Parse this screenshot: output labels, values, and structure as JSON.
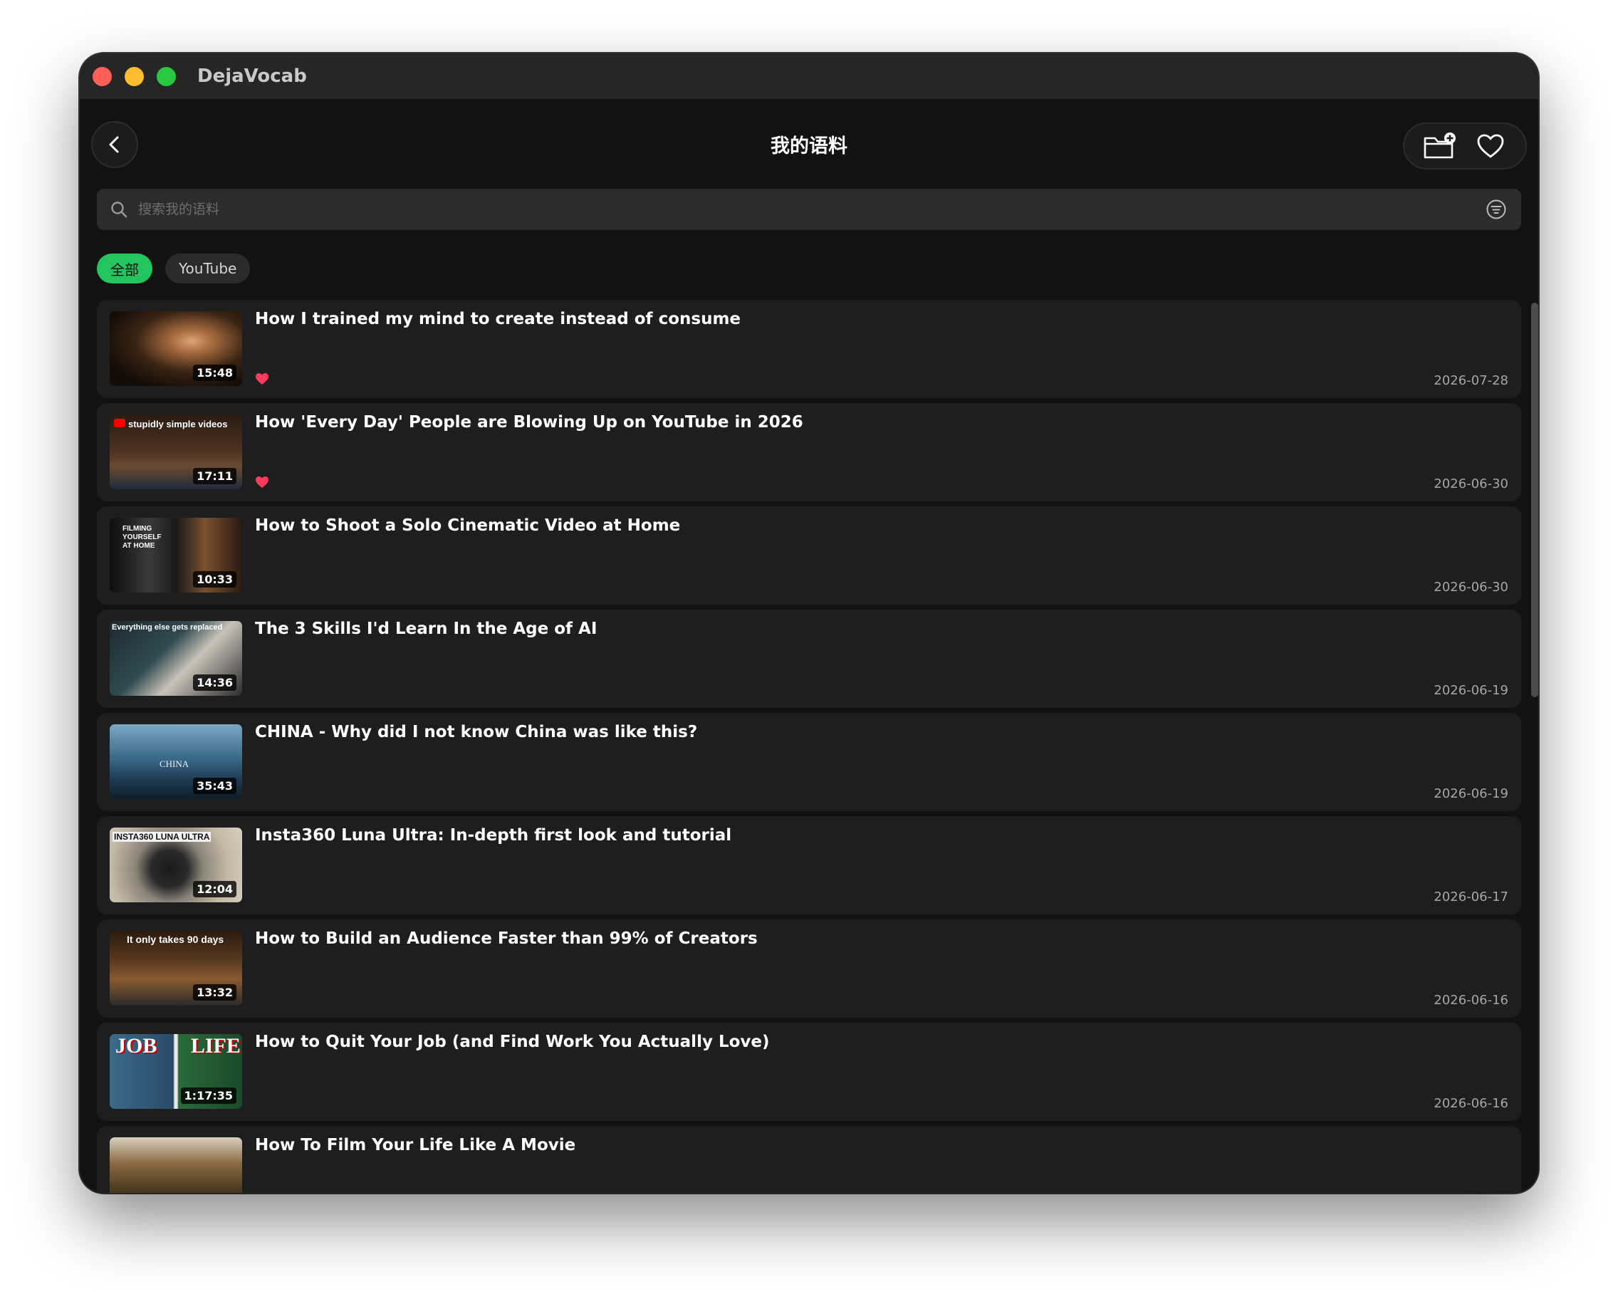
{
  "app": {
    "name": "DejaVocab"
  },
  "header": {
    "title": "我的语料"
  },
  "search": {
    "placeholder": "搜索我的语料"
  },
  "filters": [
    {
      "label": "全部",
      "active": true
    },
    {
      "label": "YouTube",
      "active": false
    }
  ],
  "colors": {
    "accent": "#22c55e",
    "heart": "#ff3b5c",
    "background": "#121212",
    "card": "#1e1e1e"
  },
  "items": [
    {
      "title": "How I trained my mind to create instead of consume",
      "duration": "15:48",
      "date": "2026-07-28",
      "favorite": true,
      "thumb_text": ""
    },
    {
      "title": "How 'Every Day' People are Blowing Up on YouTube in 2026",
      "duration": "17:11",
      "date": "2026-06-30",
      "favorite": true,
      "thumb_text": "stupidly simple videos"
    },
    {
      "title": "How to Shoot a Solo Cinematic Video at Home",
      "duration": "10:33",
      "date": "2026-06-30",
      "favorite": false,
      "thumb_text": "FILMING YOURSELF AT HOME"
    },
    {
      "title": "The 3 Skills I'd Learn In the Age of AI",
      "duration": "14:36",
      "date": "2026-06-19",
      "favorite": false,
      "thumb_text": "Everything else gets replaced"
    },
    {
      "title": "CHINA - Why did I not know China was like this?",
      "duration": "35:43",
      "date": "2026-06-19",
      "favorite": false,
      "thumb_text": "CHINA"
    },
    {
      "title": "Insta360 Luna Ultra: In-depth first look and tutorial",
      "duration": "12:04",
      "date": "2026-06-17",
      "favorite": false,
      "thumb_text": "INSTA360 LUNA ULTRA"
    },
    {
      "title": "How to Build an Audience Faster than 99% of Creators",
      "duration": "13:32",
      "date": "2026-06-16",
      "favorite": false,
      "thumb_text": "It only takes 90 days"
    },
    {
      "title": "How to Quit Your Job (and Find Work You Actually Love)",
      "duration": "1:17:35",
      "date": "2026-06-16",
      "favorite": false,
      "thumb_text": "JOB LIFE"
    },
    {
      "title": "How To Film Your Life Like A Movie",
      "duration": "",
      "date": "",
      "favorite": false,
      "thumb_text": ""
    }
  ],
  "icons": {
    "back": "chevron-left-icon",
    "new_folder": "folder-plus-icon",
    "favorites": "heart-outline-icon",
    "search": "magnifier-icon",
    "filter": "filter-lines-icon"
  }
}
